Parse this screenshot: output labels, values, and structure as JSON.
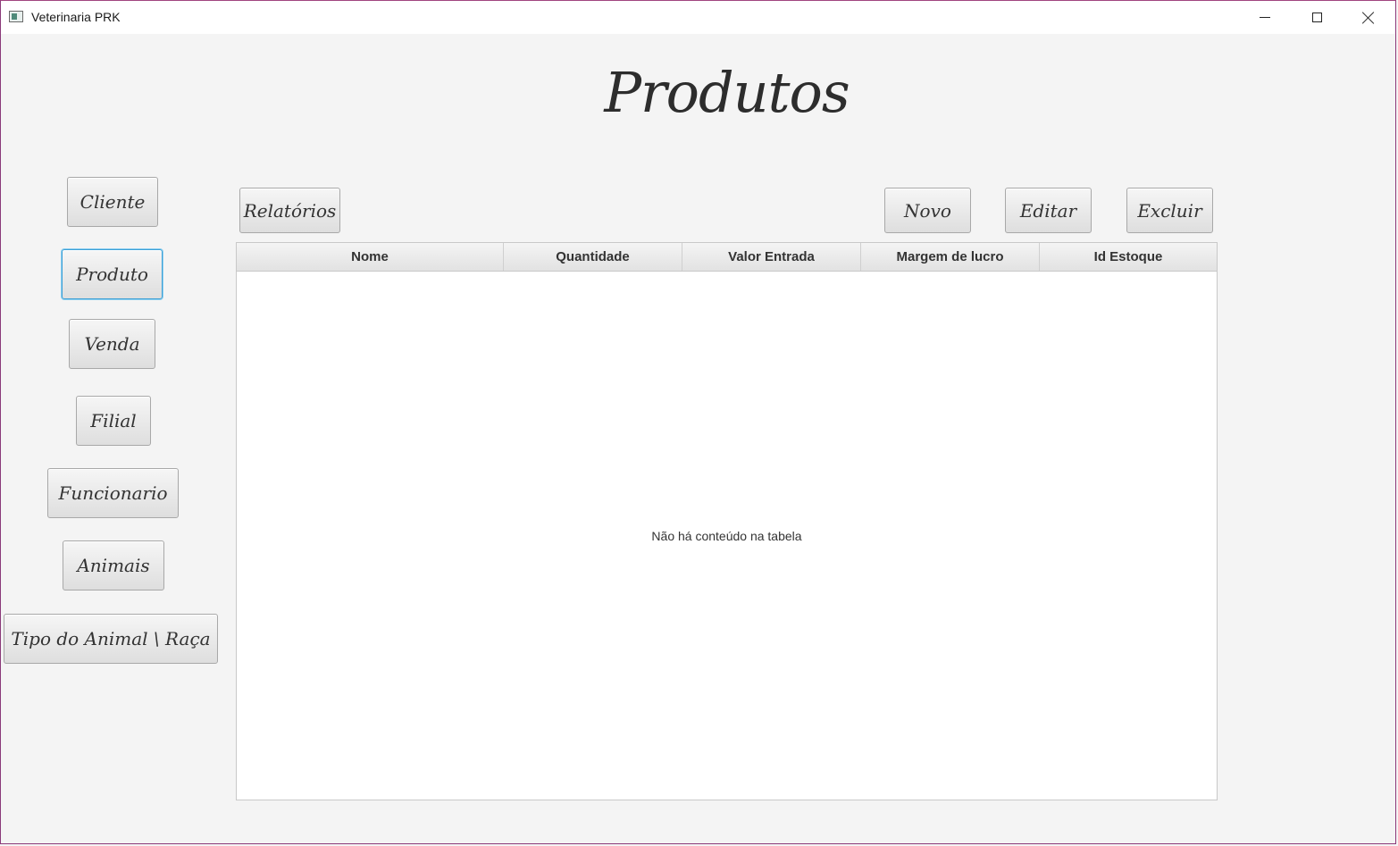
{
  "window": {
    "title": "Veterinaria PRK",
    "frame_color": "#a0457f"
  },
  "page": {
    "title": "Produtos"
  },
  "sidebar": {
    "items": [
      {
        "label": "Cliente"
      },
      {
        "label": "Produto",
        "selected": true
      },
      {
        "label": "Venda"
      },
      {
        "label": "Filial"
      },
      {
        "label": "Funcionario"
      },
      {
        "label": "Animais"
      },
      {
        "label": "Tipo do Animal \\ Raça"
      }
    ]
  },
  "toolbar": {
    "reports_label": "Relatórios",
    "new_label": "Novo",
    "edit_label": "Editar",
    "delete_label": "Excluir"
  },
  "table": {
    "columns": [
      "Nome",
      "Quantidade",
      "Valor Entrada",
      "Margem de lucro",
      "Id Estoque"
    ],
    "rows": [],
    "empty_message": "Não há conteúdo na tabela"
  },
  "colors": {
    "focus_accent": "#3c9fd6",
    "background": "#f4f4f4"
  }
}
